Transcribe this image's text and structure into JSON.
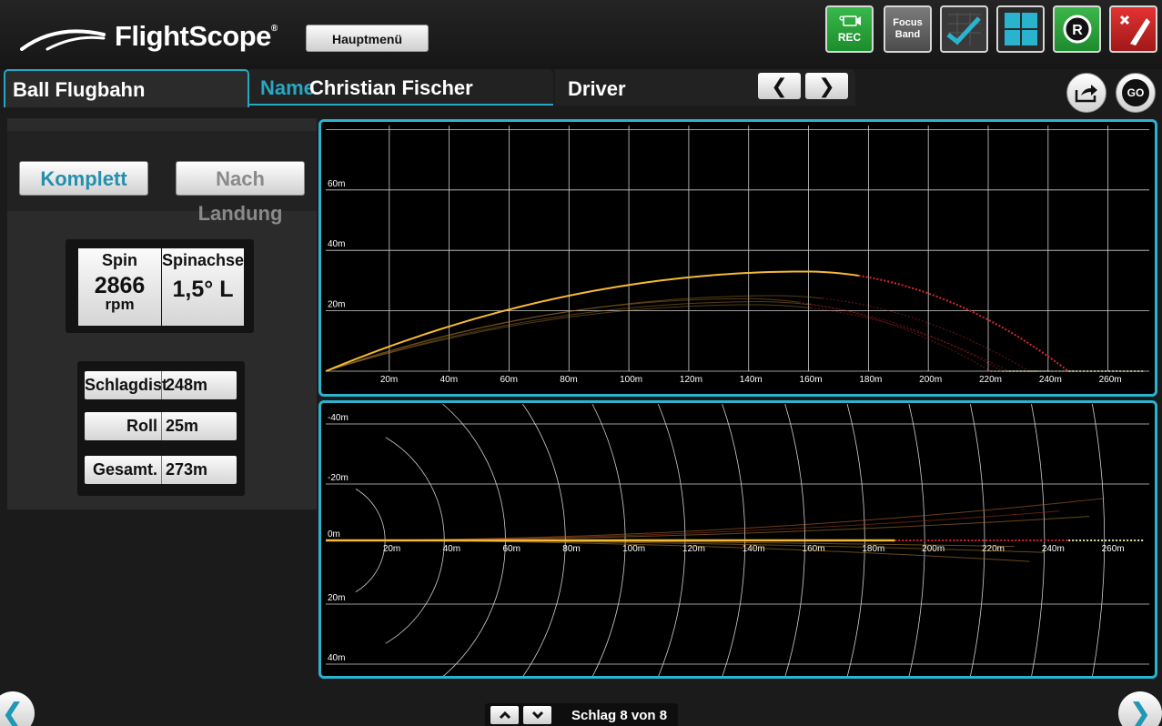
{
  "header": {
    "brand": "FlightScope",
    "menu_label": "Hauptmenü",
    "tools": [
      {
        "name": "record",
        "label": "REC",
        "icon": "camera-icon"
      },
      {
        "name": "focus-band",
        "label": "Focus\nBand",
        "icon": "focus-band-icon"
      },
      {
        "name": "chart",
        "label": "",
        "icon": "chart-check-icon"
      },
      {
        "name": "grid",
        "label": "",
        "icon": "grid-icon"
      },
      {
        "name": "r",
        "label": "R",
        "icon": "r-circle-icon"
      },
      {
        "name": "exit",
        "label": "",
        "icon": "exit-icon"
      }
    ]
  },
  "tabs": {
    "view": "Ball Flugbahn",
    "name_label": "Name",
    "player": "Christian Fischer",
    "club": "Driver",
    "prev": "❮",
    "next": "❯",
    "go": "GO"
  },
  "left": {
    "mode_active": "Komplett",
    "mode_inactive": "Nach Landung",
    "spin": {
      "label": "Spin",
      "value": "2866",
      "unit": "rpm"
    },
    "spin_axis": {
      "label": "Spinachse",
      "value": "1,5° L"
    },
    "distances": [
      {
        "label": "Schlagdist",
        "value": "248m"
      },
      {
        "label": "Roll",
        "value": "25m"
      },
      {
        "label": "Gesamt.",
        "value": "273m"
      }
    ]
  },
  "chart_data": [
    {
      "type": "line",
      "view": "side",
      "x_ticks": [
        "20m",
        "40m",
        "60m",
        "80m",
        "100m",
        "120m",
        "140m",
        "160m",
        "180m",
        "200m",
        "220m",
        "240m",
        "260m"
      ],
      "y_ticks": [
        "20m",
        "40m",
        "60m"
      ],
      "xlim": [
        0,
        275
      ],
      "ylim": [
        0,
        80
      ],
      "grid": true,
      "colors": {
        "flight": "#f5b936",
        "descent": "#d8282a",
        "roll": "#e9e9a0",
        "older": "#a8792a"
      }
    },
    {
      "type": "line",
      "view": "top",
      "x_ticks": [
        "20m",
        "40m",
        "60m",
        "80m",
        "100m",
        "120m",
        "140m",
        "160m",
        "180m",
        "200m",
        "220m",
        "240m",
        "260m"
      ],
      "y_ticks": [
        "-40m",
        "-20m",
        "0m",
        "20m",
        "40m"
      ],
      "xlim": [
        0,
        275
      ],
      "ylim": [
        -43,
        43
      ],
      "grid": true
    }
  ],
  "footer": {
    "shot_label": "Schlag 8 von 8",
    "up": "⌃",
    "down": "⌄",
    "prev": "❮",
    "next": "❯"
  }
}
